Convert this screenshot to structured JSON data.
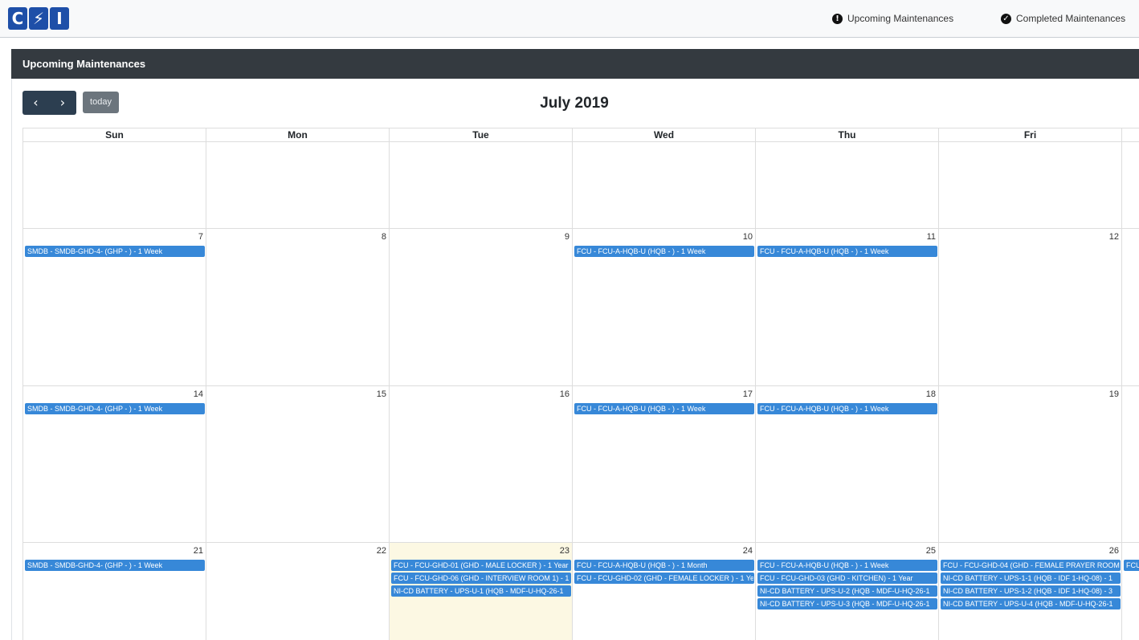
{
  "navbar": {
    "logo_letters": [
      "C",
      "⚡",
      "I"
    ],
    "links": [
      {
        "label": "Upcoming Maintenances",
        "icon": "exclamation-circle-icon",
        "glyph": "!"
      },
      {
        "label": "Completed Maintenances",
        "icon": "check-circle-icon",
        "glyph": "✓"
      }
    ]
  },
  "panel": {
    "title": "Upcoming Maintenances"
  },
  "toolbar": {
    "prev_glyph": "‹",
    "next_glyph": "›",
    "today_label": "today",
    "title": "July 2019"
  },
  "colors": {
    "event": "#3788d8",
    "header": "#343a40",
    "today_bg": "#fcf8e3",
    "nav_button": "#2c3e50"
  },
  "calendar": {
    "day_headers": [
      "Sun",
      "Mon",
      "Tue",
      "Wed",
      "Thu",
      "Fri",
      ""
    ],
    "weeks": [
      {
        "days": [
          {
            "num": "",
            "events": []
          },
          {
            "num": "",
            "events": []
          },
          {
            "num": "",
            "events": []
          },
          {
            "num": "",
            "events": []
          },
          {
            "num": "",
            "events": []
          },
          {
            "num": "",
            "events": []
          },
          {
            "num": "",
            "events": []
          }
        ]
      },
      {
        "days": [
          {
            "num": "7",
            "events": [
              "SMDB - SMDB-GHD-4- (GHP - ) - 1 Week"
            ]
          },
          {
            "num": "8",
            "events": []
          },
          {
            "num": "9",
            "events": []
          },
          {
            "num": "10",
            "events": [
              "FCU - FCU-A-HQB-U (HQB - ) - 1 Week"
            ]
          },
          {
            "num": "11",
            "events": [
              "FCU - FCU-A-HQB-U (HQB - ) - 1 Week"
            ]
          },
          {
            "num": "12",
            "events": []
          },
          {
            "num": "",
            "events": []
          }
        ]
      },
      {
        "days": [
          {
            "num": "14",
            "events": [
              "SMDB - SMDB-GHD-4- (GHP - ) - 1 Week"
            ]
          },
          {
            "num": "15",
            "events": []
          },
          {
            "num": "16",
            "events": []
          },
          {
            "num": "17",
            "events": [
              "FCU - FCU-A-HQB-U (HQB - ) - 1 Week"
            ]
          },
          {
            "num": "18",
            "events": [
              "FCU - FCU-A-HQB-U (HQB - ) - 1 Week"
            ]
          },
          {
            "num": "19",
            "events": []
          },
          {
            "num": "",
            "events": []
          }
        ]
      },
      {
        "days": [
          {
            "num": "21",
            "events": [
              "SMDB - SMDB-GHD-4- (GHP - ) - 1 Week"
            ]
          },
          {
            "num": "22",
            "events": []
          },
          {
            "num": "23",
            "today": true,
            "events": [
              "FCU - FCU-GHD-01 (GHD - MALE LOCKER ) - 1 Year",
              "FCU - FCU-GHD-06 (GHD - INTERVIEW ROOM 1) - 1",
              "NI-CD BATTERY - UPS-U-1 (HQB - MDF-U-HQ-26-1"
            ]
          },
          {
            "num": "24",
            "events": [
              "FCU - FCU-A-HQB-U (HQB - ) - 1 Month",
              "FCU - FCU-GHD-02 (GHD - FEMALE LOCKER ) - 1 Ye"
            ]
          },
          {
            "num": "25",
            "events": [
              "FCU - FCU-A-HQB-U (HQB - ) - 1 Week",
              "FCU - FCU-GHD-03 (GHD - KITCHEN) - 1 Year",
              "NI-CD BATTERY - UPS-U-2 (HQB - MDF-U-HQ-26-1",
              "NI-CD BATTERY - UPS-U-3 (HQB - MDF-U-HQ-26-1"
            ]
          },
          {
            "num": "26",
            "events": [
              "FCU - FCU-GHD-04 (GHD - FEMALE PRAYER ROOM",
              "NI-CD BATTERY - UPS-1-1 (HQB - IDF 1-HQ-08) - 1",
              "NI-CD BATTERY - UPS-1-2 (HQB - IDF 1-HQ-08) - 3",
              "NI-CD BATTERY - UPS-U-4 (HQB - MDF-U-HQ-26-1"
            ]
          },
          {
            "num": "",
            "events": [
              "FCU"
            ]
          }
        ]
      }
    ]
  }
}
